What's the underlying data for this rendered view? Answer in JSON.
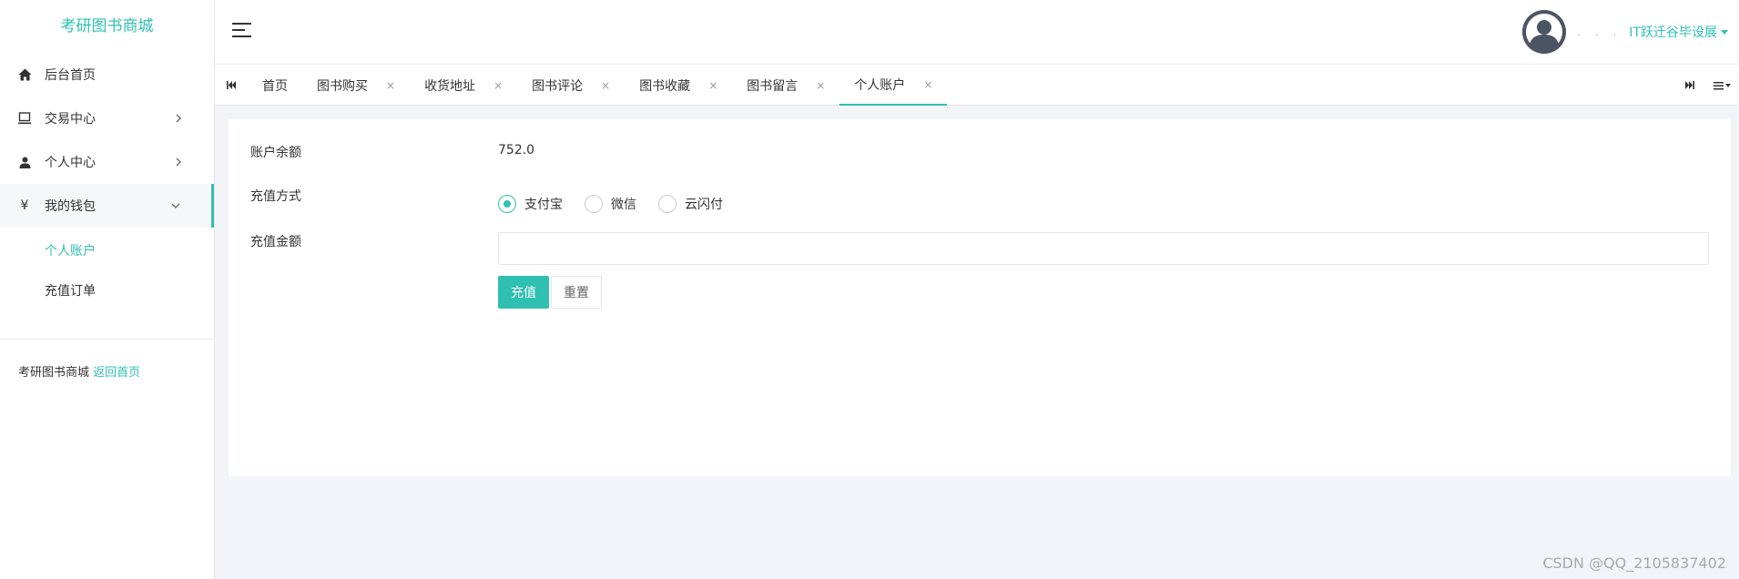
{
  "sidebar": {
    "brand": "考研图书商城",
    "items": [
      {
        "label": "后台首页",
        "icon": "home-icon"
      },
      {
        "label": "交易中心",
        "icon": "monitor-icon"
      },
      {
        "label": "个人中心",
        "icon": "user-icon"
      },
      {
        "label": "我的钱包",
        "icon": "yen-icon"
      }
    ],
    "submenu": [
      {
        "label": "个人账户"
      },
      {
        "label": "充值订单"
      }
    ],
    "footer_text": "考研图书商城",
    "footer_link": "返回首页"
  },
  "header": {
    "user_dots": ". . .",
    "user_name": "IT跃迁谷毕设展"
  },
  "tabs": [
    {
      "label": "首页"
    },
    {
      "label": "图书购买"
    },
    {
      "label": "收货地址"
    },
    {
      "label": "图书评论"
    },
    {
      "label": "图书收藏"
    },
    {
      "label": "图书留言"
    },
    {
      "label": "个人账户"
    }
  ],
  "tab_close_glyph": "×",
  "form": {
    "balance_label": "账户余额",
    "balance_value": "752.0",
    "method_label": "充值方式",
    "methods": [
      {
        "label": "支付宝",
        "checked": true
      },
      {
        "label": "微信",
        "checked": false
      },
      {
        "label": "云闪付",
        "checked": false
      }
    ],
    "amount_label": "充值金额",
    "amount_value": "",
    "recharge_button": "充值",
    "reset_button": "重置"
  },
  "watermark": "CSDN @QQ_2105837402",
  "colors": {
    "accent": "#2fc0b1",
    "background": "#f3f4f8"
  }
}
